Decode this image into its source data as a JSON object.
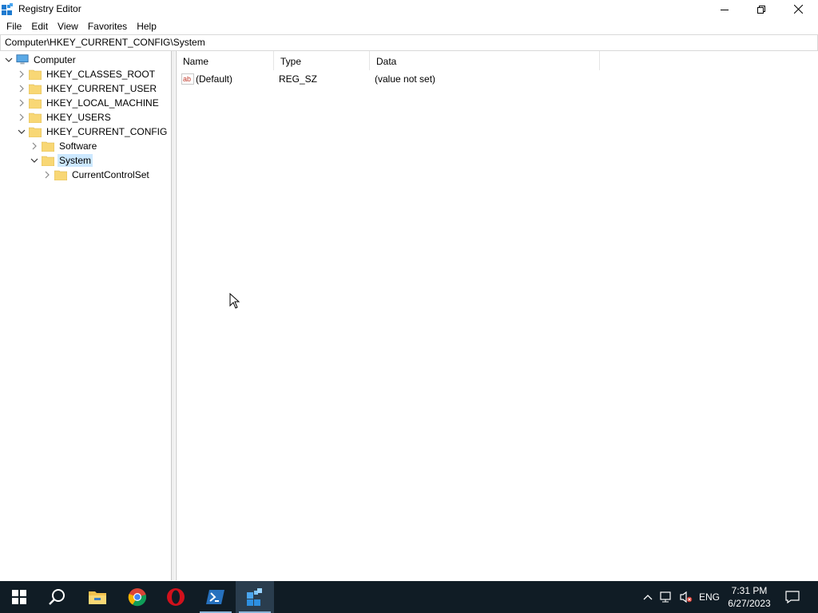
{
  "window": {
    "title": "Registry Editor",
    "icon": "registry-editor-icon"
  },
  "menu": [
    "File",
    "Edit",
    "View",
    "Favorites",
    "Help"
  ],
  "address": "Computer\\HKEY_CURRENT_CONFIG\\System",
  "tree": {
    "root": "Computer",
    "hives": [
      "HKEY_CLASSES_ROOT",
      "HKEY_CURRENT_USER",
      "HKEY_LOCAL_MACHINE",
      "HKEY_USERS",
      "HKEY_CURRENT_CONFIG"
    ],
    "children": [
      "Software",
      "System"
    ],
    "grandchild": "CurrentControlSet",
    "selected": "System"
  },
  "values": {
    "columns": [
      "Name",
      "Type",
      "Data"
    ],
    "rows": [
      {
        "name": "(Default)",
        "type": "REG_SZ",
        "data": "(value not set)",
        "icon": "string-value-icon"
      }
    ]
  },
  "taskbar": {
    "apps": [
      "start-icon",
      "search-icon",
      "file-explorer-icon",
      "chrome-icon",
      "opera-icon",
      "powershell-icon",
      "registry-editor-icon"
    ],
    "active": "registry-editor-icon",
    "language": "ENG",
    "time": "7:31 PM",
    "date": "6/27/2023"
  },
  "colors": {
    "selection": "#cce8ff",
    "taskbar": "#101c25",
    "folder": "#f8d775"
  }
}
